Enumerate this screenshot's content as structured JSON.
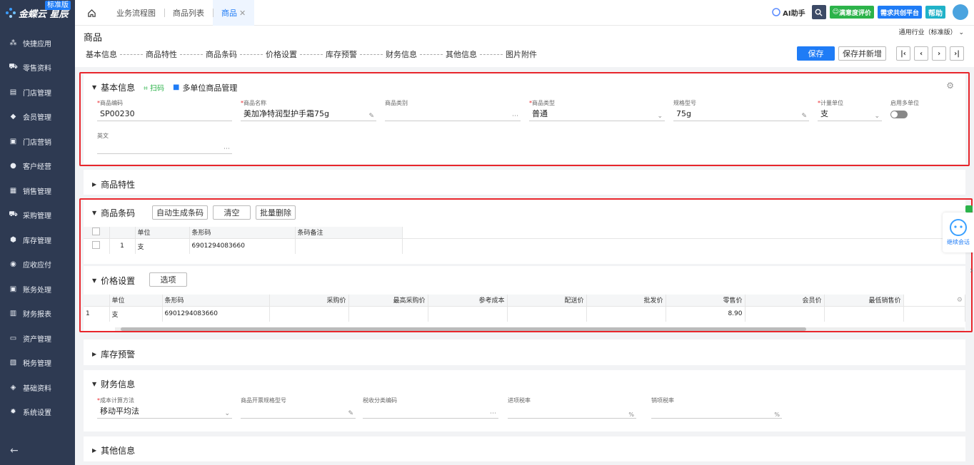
{
  "app": {
    "name": "金蝶云",
    "sub": "星辰",
    "badge": "标准版"
  },
  "sidebar": {
    "items": [
      {
        "label": "快捷应用",
        "icon": "apps-icon"
      },
      {
        "label": "零售资料",
        "icon": "shop-cart-icon"
      },
      {
        "label": "门店管理",
        "icon": "store-icon"
      },
      {
        "label": "会员管理",
        "icon": "diamond-icon"
      },
      {
        "label": "门店营销",
        "icon": "bag-icon"
      },
      {
        "label": "客户经营",
        "icon": "user-icon"
      },
      {
        "label": "销售管理",
        "icon": "chart-icon"
      },
      {
        "label": "采购管理",
        "icon": "cart-icon"
      },
      {
        "label": "库存管理",
        "icon": "box-icon"
      },
      {
        "label": "应收应付",
        "icon": "money-icon"
      },
      {
        "label": "账务处理",
        "icon": "ledger-icon"
      },
      {
        "label": "财务报表",
        "icon": "report-icon"
      },
      {
        "label": "资产管理",
        "icon": "asset-icon"
      },
      {
        "label": "税务管理",
        "icon": "tax-icon"
      },
      {
        "label": "基础资料",
        "icon": "layers-icon"
      },
      {
        "label": "系统设置",
        "icon": "gear-icon"
      }
    ]
  },
  "tabs": [
    {
      "label": "业务流程图"
    },
    {
      "label": "商品列表"
    },
    {
      "label": "商品",
      "active": true
    }
  ],
  "topright": {
    "ai": "AI助手",
    "review": "满意度评价",
    "demand": "需求共创平台",
    "help": "帮助"
  },
  "header": {
    "title": "商品",
    "industry": "通用行业（标准版）",
    "save": "保存",
    "save_new": "保存并新增"
  },
  "anchors": [
    "基本信息",
    "商品特性",
    "商品条码",
    "价格设置",
    "库存预警",
    "财务信息",
    "其他信息",
    "图片附件"
  ],
  "basic": {
    "title": "基本信息",
    "scan": "扫码",
    "multi_unit": "多单位商品管理",
    "fields": [
      {
        "label": "商品编码",
        "required": true,
        "value": "SP00230"
      },
      {
        "label": "商品名称",
        "required": true,
        "value": "美加净特润型护手霜75g"
      },
      {
        "label": "商品类别",
        "required": false,
        "value": ""
      },
      {
        "label": "商品类型",
        "required": true,
        "value": "普通"
      },
      {
        "label": "规格型号",
        "required": false,
        "value": "75g"
      },
      {
        "label": "计量单位",
        "required": true,
        "value": "支"
      },
      {
        "label": "启用多单位",
        "required": false,
        "value": ""
      }
    ],
    "english_label": "英文",
    "english_value": ""
  },
  "features": {
    "title": "商品特性"
  },
  "barcode": {
    "title": "商品条码",
    "btn_auto": "自动生成条码",
    "btn_clear": "清空",
    "btn_batch_delete": "批量删除",
    "columns": [
      "单位",
      "条形码",
      "条码备注"
    ],
    "rows": [
      {
        "no": "1",
        "unit": "支",
        "barcode": "6901294083660",
        "remark": ""
      }
    ]
  },
  "price": {
    "title": "价格设置",
    "btn_options": "选项",
    "columns": [
      "单位",
      "条形码",
      "采购价",
      "最高采购价",
      "参考成本",
      "配送价",
      "批发价",
      "零售价",
      "会员价",
      "最低销售价"
    ],
    "rows": [
      {
        "no": "1",
        "unit": "支",
        "barcode": "6901294083660",
        "retail": "8.90"
      }
    ]
  },
  "stock": {
    "title": "库存预警"
  },
  "finance": {
    "title": "财务信息",
    "fields": [
      {
        "label": "成本计算方法",
        "required": true,
        "value": "移动平均法"
      },
      {
        "label": "商品开票规格型号",
        "required": false,
        "value": ""
      },
      {
        "label": "税收分类编码",
        "required": false,
        "value": ""
      },
      {
        "label": "进项税率",
        "required": false,
        "value": "",
        "suffix": "%"
      },
      {
        "label": "销项税率",
        "required": false,
        "value": "",
        "suffix": "%"
      }
    ]
  },
  "other": {
    "title": "其他信息"
  },
  "widget": {
    "label": "继续会话"
  }
}
